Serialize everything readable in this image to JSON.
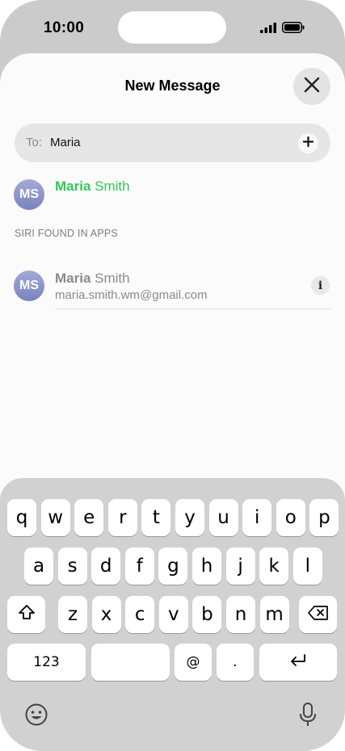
{
  "status_bar": {
    "time": "10:00",
    "icons": [
      "cellular-signal-icon",
      "battery-icon"
    ]
  },
  "sheet": {
    "title": "New Message",
    "close_icon": "close-icon"
  },
  "to_field": {
    "label": "To:",
    "value": "Maria",
    "add_icon": "plus-icon"
  },
  "suggestion": {
    "initials": "MS",
    "name_match": "Maria",
    "name_rest": " Smith",
    "color": "#34c759"
  },
  "siri_section": {
    "header": "SIRI FOUND IN APPS",
    "contact": {
      "initials": "MS",
      "name_match": "Maria",
      "name_rest": " Smith",
      "email": "maria.smith.wm@gmail.com",
      "info_label": "i"
    }
  },
  "keyboard": {
    "row1": [
      "q",
      "w",
      "e",
      "r",
      "t",
      "y",
      "u",
      "i",
      "o",
      "p"
    ],
    "row2": [
      "a",
      "s",
      "d",
      "f",
      "g",
      "h",
      "j",
      "k",
      "l"
    ],
    "row3": [
      "z",
      "x",
      "c",
      "v",
      "b",
      "n",
      "m"
    ],
    "shift_icon": "shift-icon",
    "delete_icon": "delete-icon",
    "numbers_label": "123",
    "at_label": "@",
    "dot_label": ".",
    "return_icon": "return-icon",
    "emoji_icon": "emoji-icon",
    "mic_icon": "microphone-icon"
  }
}
